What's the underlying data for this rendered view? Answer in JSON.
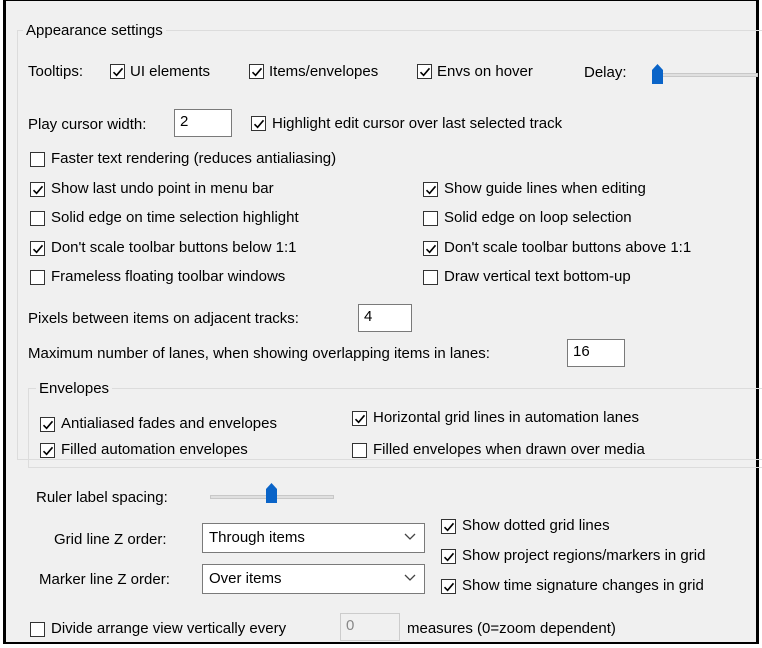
{
  "appearance": {
    "title": "Appearance settings",
    "tooltips_label": "Tooltips:",
    "tooltips_ui": {
      "label": "UI elements",
      "checked": true
    },
    "tooltips_items": {
      "label": "Items/envelopes",
      "checked": true
    },
    "tooltips_envs": {
      "label": "Envs on hover",
      "checked": true
    },
    "delay_label": "Delay:",
    "play_cursor_label": "Play cursor width:",
    "play_cursor_value": "2",
    "highlight_edit": {
      "label": "Highlight edit cursor over last selected track",
      "checked": true
    },
    "faster_text": {
      "label": "Faster text rendering (reduces antialiasing)",
      "checked": false
    },
    "show_undo": {
      "label": "Show last undo point in menu bar",
      "checked": true
    },
    "show_guide": {
      "label": "Show guide lines when editing",
      "checked": true
    },
    "solid_time_sel": {
      "label": "Solid edge on time selection highlight",
      "checked": false
    },
    "solid_loop_sel": {
      "label": "Solid edge on loop selection",
      "checked": false
    },
    "no_scale_below": {
      "label": "Don't scale toolbar buttons below 1:1",
      "checked": true
    },
    "no_scale_above": {
      "label": "Don't scale toolbar buttons above 1:1",
      "checked": true
    },
    "frameless": {
      "label": "Frameless floating toolbar windows",
      "checked": false
    },
    "vertical_text": {
      "label": "Draw vertical text bottom-up",
      "checked": false
    },
    "pixels_label": "Pixels between items on adjacent tracks:",
    "pixels_value": "4",
    "max_lanes_label": "Maximum number of lanes, when showing overlapping items in lanes:",
    "max_lanes_value": "16"
  },
  "envelopes": {
    "title": "Envelopes",
    "antialiased": {
      "label": "Antialiased fades and envelopes",
      "checked": true
    },
    "horizontal_grid": {
      "label": "Horizontal grid lines in automation lanes",
      "checked": true
    },
    "filled_auto": {
      "label": "Filled automation envelopes",
      "checked": true
    },
    "filled_media": {
      "label": "Filled envelopes when drawn over media",
      "checked": false
    }
  },
  "ruler": {
    "label": "Ruler label spacing:",
    "grid_z_label": "Grid line Z order:",
    "grid_z_value": "Through items",
    "marker_z_label": "Marker line Z order:",
    "marker_z_value": "Over items",
    "dotted": {
      "label": "Show dotted grid lines",
      "checked": true
    },
    "regions": {
      "label": "Show project regions/markers in grid",
      "checked": true
    },
    "timesig": {
      "label": "Show time signature changes in grid",
      "checked": true
    }
  },
  "divide": {
    "label": "Divide arrange view vertically every",
    "checked": false,
    "value": "0",
    "suffix": "measures (0=zoom dependent)"
  },
  "icons": {
    "check": "checkmark-icon",
    "dropdown": "chevron-down-icon"
  },
  "colors": {
    "accent": "#0a64c8",
    "panel": "#f0f0f0"
  }
}
